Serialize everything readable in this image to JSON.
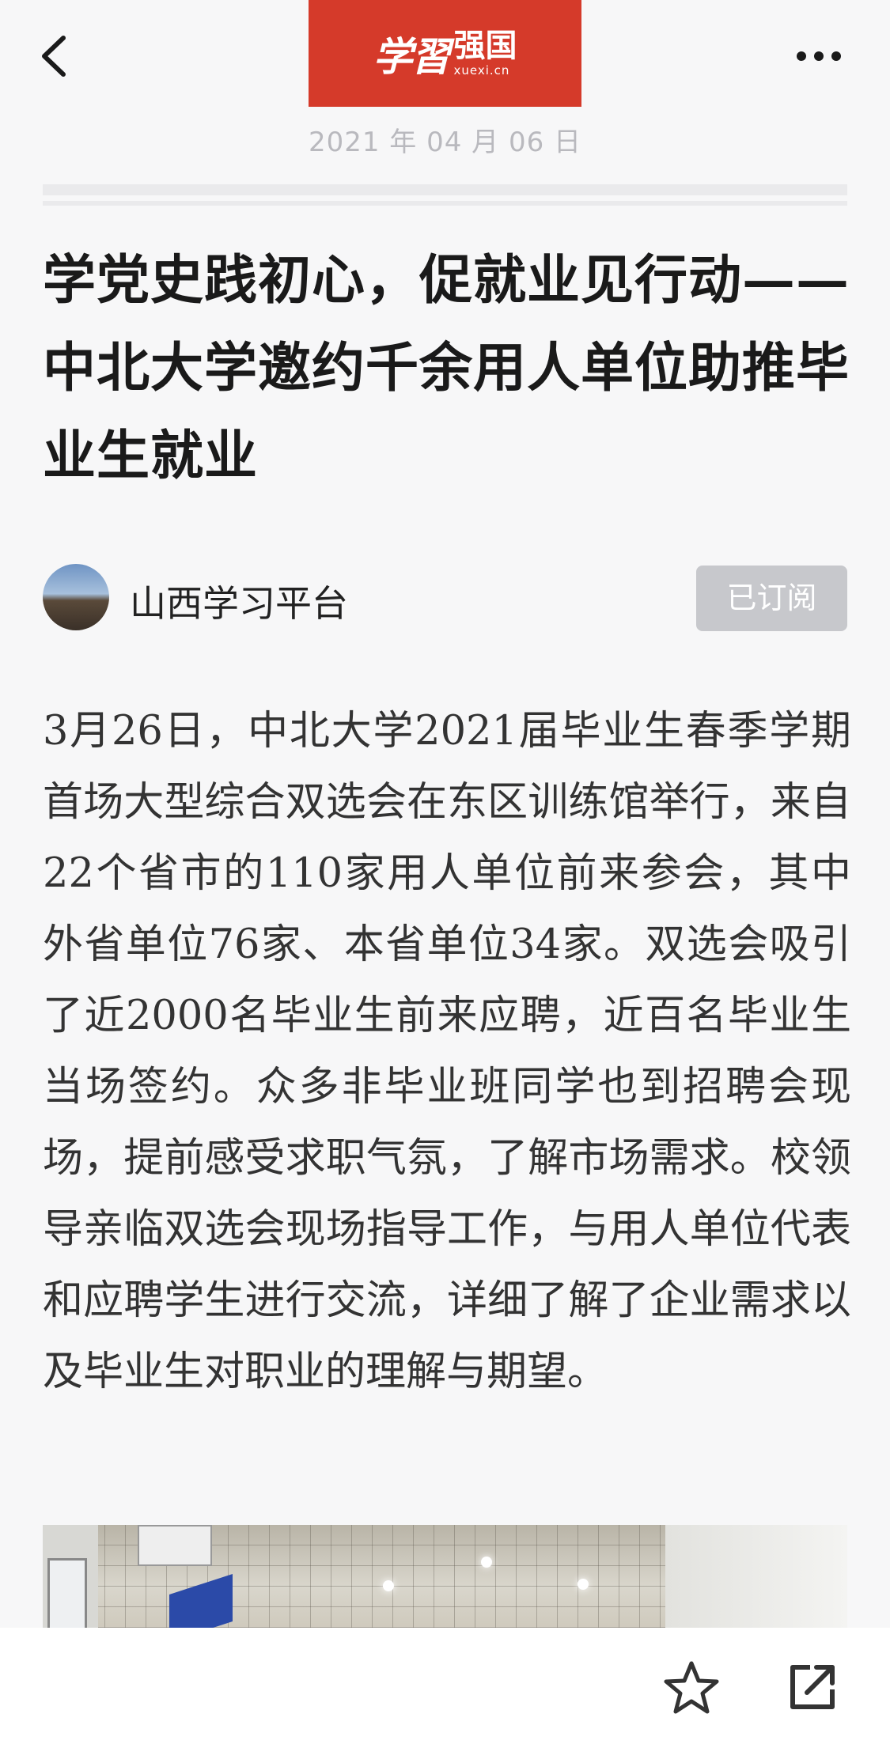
{
  "header": {
    "logo": {
      "brand": "学習",
      "name": "强国",
      "domain": "xuexi.cn"
    },
    "date": "2021 年 04 月 06 日"
  },
  "article": {
    "title": "学党史践初心，促就业见行动——中北大学邀约千余用人单位助推毕业生就业",
    "author": "山西学习平台",
    "subscribe_label": "已订阅",
    "body": "3月26日，中北大学2021届毕业生春季学期首场大型综合双选会在东区训练馆举行，来自22个省市的110家用人单位前来参会，其中外省单位76家、本省单位34家。双选会吸引了近2000名毕业生前来应聘，近百名毕业生当场签约。众多非毕业班同学也到招聘会现场，提前感受求职气氛，了解市场需求。校领导亲临双选会现场指导工作，与用人单位代表和应聘学生进行交流，详细了解了企业需求以及毕业生对职业的理解与期望。"
  },
  "icons": {
    "back": "chevron-left-icon",
    "more": "more-horizontal-icon",
    "favorite": "star-outline-icon",
    "share": "share-external-icon"
  },
  "colors": {
    "brand_red": "#d53a2a",
    "subscribed_bg": "#c7c8cc",
    "page_bg": "#f7f7f8"
  }
}
